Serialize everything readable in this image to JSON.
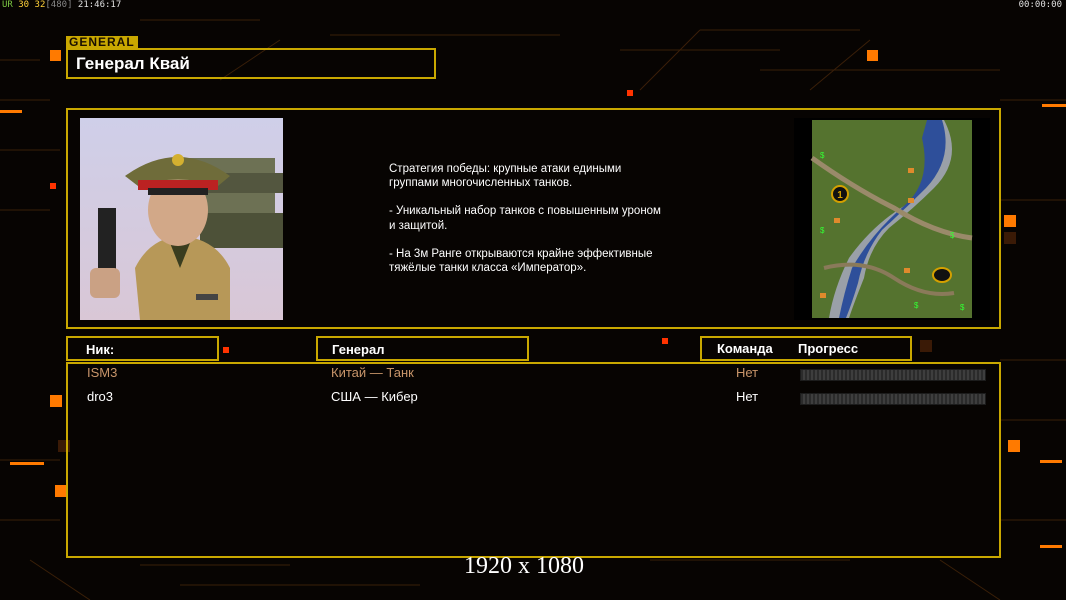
{
  "hud": {
    "fps": "30",
    "fps2": "32",
    "max": "480",
    "version": "UR",
    "clock": "21:46:17",
    "timer": "00:00:00"
  },
  "tag": "GENERAL",
  "general_name": "Генерал Квай",
  "description": [
    "Стратегия победы: крупные атаки едиными\n группами многочисленных танков.",
    "- Уникальный набор танков с повышенным уроном\n и защитой.",
    "- На 3м Ранге открываются крайне эффективные\n тяжёлые танки класса «Император»."
  ],
  "headers": {
    "nick": "Ник:",
    "general": "Генерал",
    "team": "Команда",
    "progress": "Прогресс"
  },
  "players": [
    {
      "nick": "ISM3",
      "general": "Китай — Танк",
      "team": "Нет",
      "color": "#c8956a",
      "progress": 0
    },
    {
      "nick": "dro3",
      "general": "США — Кибер",
      "team": "Нет",
      "color": "#ffffff",
      "progress": 0
    }
  ],
  "resolution": "1920 x 1080",
  "colors": {
    "frame": "#c9a800",
    "accent": "#ff7a00",
    "background": "#070402"
  },
  "minimap_markers": [
    "1",
    "2"
  ]
}
